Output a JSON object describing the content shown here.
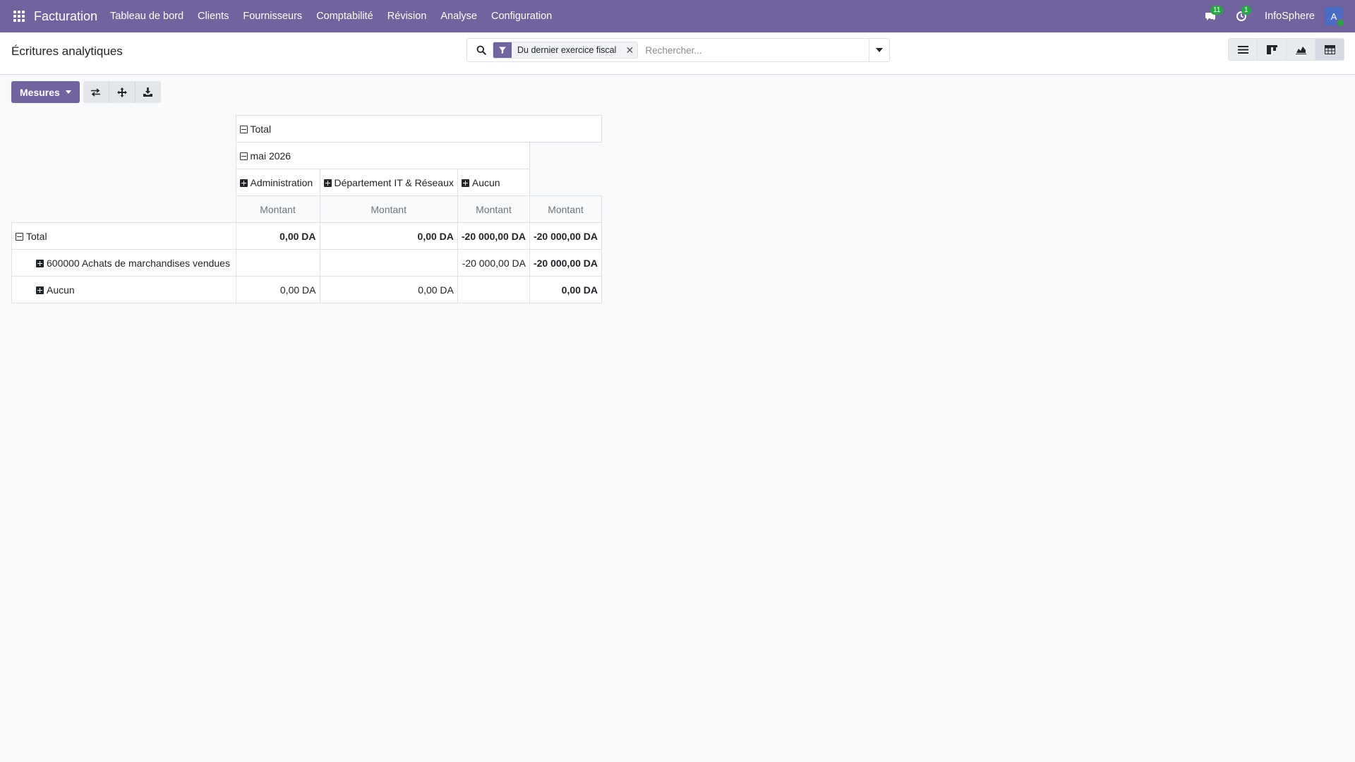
{
  "navbar": {
    "brand": "Facturation",
    "menu": [
      "Tableau de bord",
      "Clients",
      "Fournisseurs",
      "Comptabilité",
      "Révision",
      "Analyse",
      "Configuration"
    ],
    "messages_count": "11",
    "activities_count": "1",
    "company": "InfoSphere",
    "avatar_letter": "A"
  },
  "control_panel": {
    "title": "Écritures analytiques",
    "search": {
      "facet_label": "Du dernier exercice fiscal",
      "placeholder": "Rechercher..."
    },
    "views": [
      "list-view-icon",
      "kanban-view-icon",
      "graph-view-icon",
      "pivot-view-icon"
    ],
    "active_view": "pivot"
  },
  "toolbar": {
    "measures_label": "Mesures"
  },
  "pivot": {
    "col_total": "Total",
    "col_period": "mai 2026",
    "col_groups": [
      "Administration",
      "Département IT & Réseaux",
      "Aucun"
    ],
    "measure_label": "Montant",
    "rows": [
      {
        "label": "Total",
        "values": [
          "0,00 DA",
          "0,00 DA",
          "-20 000,00 DA",
          "-20 000,00 DA"
        ]
      },
      {
        "label": "600000 Achats de marchandises vendues",
        "values": [
          "",
          "",
          "-20 000,00 DA",
          "-20 000,00 DA"
        ]
      },
      {
        "label": "Aucun",
        "values": [
          "0,00 DA",
          "0,00 DA",
          "",
          "0,00 DA"
        ]
      }
    ]
  },
  "colors": {
    "brand": "#71639e",
    "badge": "#28a745"
  }
}
